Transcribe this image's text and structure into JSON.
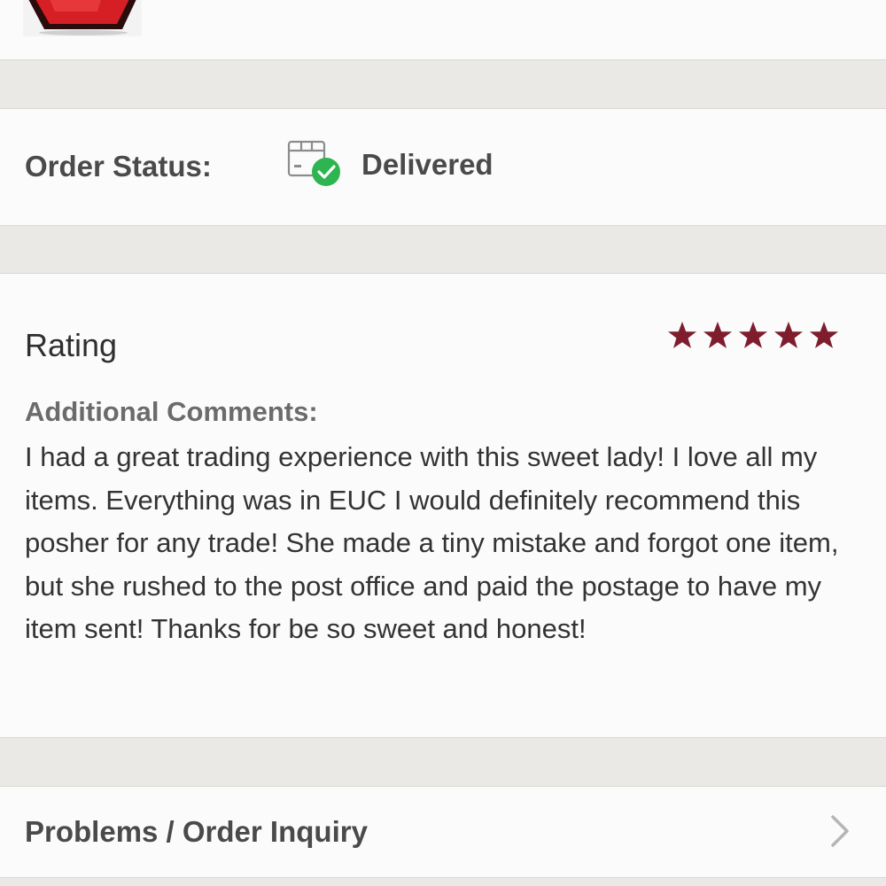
{
  "order_status": {
    "label": "Order Status:",
    "icon": "package-delivered-icon",
    "value": "Delivered",
    "status_color": "#2eb450"
  },
  "rating": {
    "title": "Rating",
    "stars": 5,
    "max_stars": 5,
    "star_color": "#7f1d2d",
    "comments_heading": "Additional Comments:",
    "comments_text": "I had a great trading experience with this sweet lady! I love all my items. Everything was in EUC I would definitely recommend this posher for any trade! She made a tiny mistake and forgot one item, but she rushed to the post office and paid the postage to have my item sent! Thanks for be so sweet and honest!"
  },
  "problems": {
    "label": "Problems / Order Inquiry",
    "icon": "chevron-right-icon"
  }
}
